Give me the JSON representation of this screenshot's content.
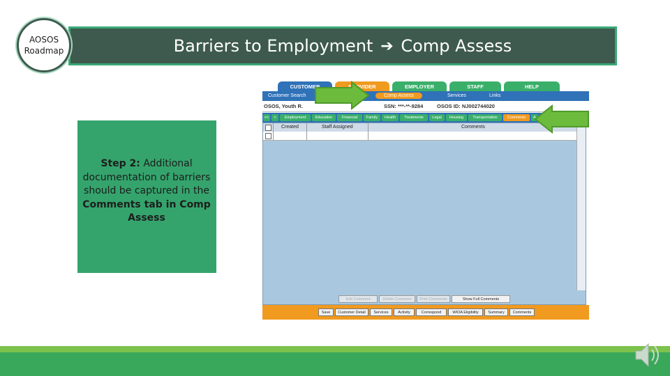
{
  "roadmap": {
    "line1": "AOSOS",
    "line2": "Roadmap"
  },
  "title": {
    "left": "Barriers to Employment",
    "arrow": "➔",
    "right": "Comp Assess"
  },
  "step": {
    "label": "Step 2:",
    "text": "Additional documentation of barriers should be captured in the",
    "bold": "Comments tab in Comp",
    "tail": "Assess"
  },
  "app": {
    "top_tabs": [
      "CUSTOMER",
      "PROVIDER",
      "EMPLOYER",
      "STAFF",
      "HELP"
    ],
    "nav": {
      "customer_search": "Customer Search",
      "comp_assess": "Comp Assess",
      "services": "Services",
      "links": "Links"
    },
    "customer": {
      "name": "OSOS, Youth R.",
      "ssn": "SSN: ***-**-9284",
      "osos_id": "OSOS ID: NJ002744020"
    },
    "subtabs": [
      "<<",
      "<",
      "Employment",
      "Education",
      "Financial",
      "Family",
      "Health",
      "Treatments",
      "Legal",
      "Housing",
      "Transportation",
      "Comments",
      "A"
    ],
    "grid_headers": {
      "created": "Created",
      "staff": "Staff Assigned",
      "comments": "Comments"
    },
    "grid_buttons": [
      "Edit Comment",
      "Delete Comment",
      "Print Comments",
      "Show Full Comments"
    ],
    "footer_buttons": [
      "Save",
      "Customer Detail",
      "Services",
      "Activity",
      "Correspond",
      "WIOA Eligibility",
      "Summary",
      "Comments"
    ]
  },
  "colors": {
    "banner": "#3e5a4e",
    "banner_border": "#3aa876",
    "step_box": "#34a46c",
    "nav_blue": "#2f72b8",
    "orange": "#f09a1f",
    "arrow_green": "#6cbb3c"
  },
  "icons": {
    "arrow1": "green-right-arrow-icon",
    "arrow2": "green-left-arrow-icon",
    "speaker": "speaker-icon"
  }
}
